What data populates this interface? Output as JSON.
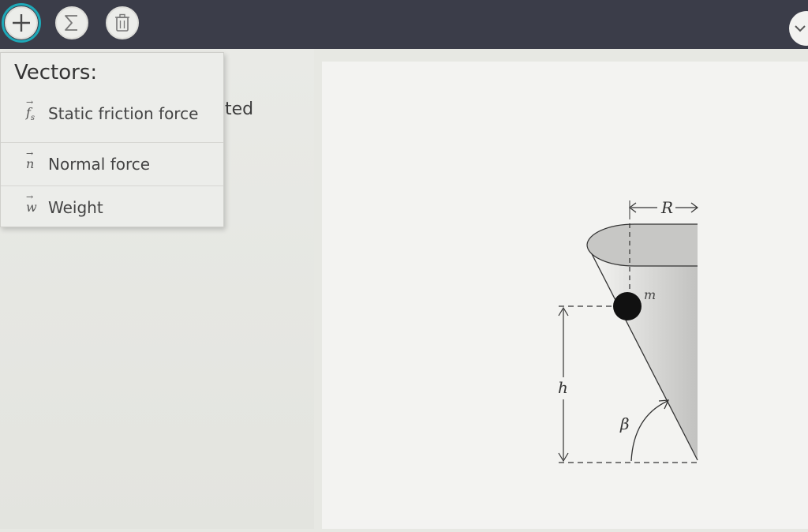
{
  "toolbar": {
    "buttons": [
      {
        "name": "add-vector-button",
        "icon": "plus-icon"
      },
      {
        "name": "sum-vectors-button",
        "icon": "sigma-icon"
      },
      {
        "name": "delete-button",
        "icon": "trash-icon"
      }
    ],
    "accent": "#1ea9b8",
    "background": "#3b3d49"
  },
  "dropdown": {
    "title": "Vectors:",
    "items": [
      {
        "symbol": "f",
        "subscript": "s",
        "label": "Static friction force"
      },
      {
        "symbol": "n",
        "label": "Normal force"
      },
      {
        "symbol": "w",
        "label": "Weight"
      }
    ]
  },
  "left_pane": {
    "partial_text": "ted"
  },
  "figure": {
    "radius_label": "R",
    "mass_label": "m",
    "height_label": "h",
    "angle_label": "β"
  }
}
